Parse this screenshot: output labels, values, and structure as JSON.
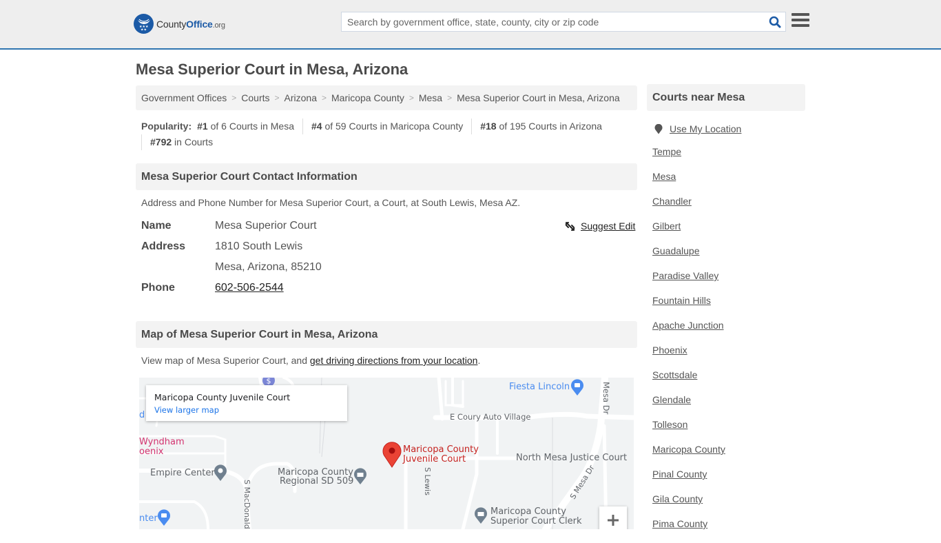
{
  "header": {
    "logo": {
      "county": "County",
      "office": "Office",
      "org": ".org"
    },
    "search_placeholder": "Search by government office, state, county, city or zip code",
    "search_icon": "search-icon",
    "menu_icon": "hamburger-menu-icon",
    "accent_color": "#2f75b0"
  },
  "page_title": "Mesa Superior Court in Mesa, Arizona",
  "breadcrumb": [
    "Government Offices",
    "Courts",
    "Arizona",
    "Maricopa County",
    "Mesa",
    "Mesa Superior Court in Mesa, Arizona"
  ],
  "popularity": {
    "label": "Popularity:",
    "items": [
      {
        "rank": "#1",
        "text": " of 6 Courts in Mesa"
      },
      {
        "rank": "#4",
        "text": " of 59 Courts in Maricopa County"
      },
      {
        "rank": "#18",
        "text": " of 195 Courts in Arizona"
      },
      {
        "rank": "#792",
        "text": " in Courts"
      }
    ]
  },
  "contact": {
    "heading": "Mesa Superior Court Contact Information",
    "description": "Address and Phone Number for Mesa Superior Court, a Court, at South Lewis, Mesa AZ.",
    "suggest_edit": "Suggest Edit",
    "name_label": "Name",
    "name": "Mesa Superior Court",
    "address_label": "Address",
    "address_line1": "1810 South Lewis",
    "address_line2": "Mesa, Arizona, 85210",
    "phone_label": "Phone",
    "phone": "602-506-2544"
  },
  "map_section": {
    "heading": "Map of Mesa Superior Court in Mesa, Arizona",
    "desc_prefix": "View map of Mesa Superior Court, and ",
    "desc_link": "get driving directions from your location",
    "desc_suffix": ".",
    "card_title": "Maricopa County Juvenile Court",
    "card_link": "View larger map",
    "zoom_in": "+",
    "labels": {
      "fiesta": "Fiesta Lincoln",
      "coury": "E Coury Auto Village",
      "mesa_dr_n": "Mesa Dr",
      "wyndham1": "Wyndham",
      "wyndham2": "oenix",
      "d_edge": "d",
      "marker1": "Maricopa County",
      "marker2": "Juvenile Court",
      "north_mesa": "North Mesa Justice Court",
      "empire": "Empire Center",
      "regional1": "Maricopa County",
      "regional2": "Regional SD 509",
      "macdonald": "S MacDonald",
      "lewis": "S Lewis",
      "s_mesa_dr": "S Mesa Dr",
      "center": "nter",
      "clerk1": "Maricopa County",
      "clerk2": "Superior Court Clerk"
    }
  },
  "sidebar": {
    "heading": "Courts near Mesa",
    "use_location": "Use My Location",
    "links": [
      "Tempe",
      "Mesa",
      "Chandler",
      "Gilbert",
      "Guadalupe",
      "Paradise Valley",
      "Fountain Hills",
      "Apache Junction",
      "Phoenix",
      "Scottsdale",
      "Glendale",
      "Tolleson",
      "Maricopa County",
      "Pinal County",
      "Gila County",
      "Pima County"
    ]
  }
}
